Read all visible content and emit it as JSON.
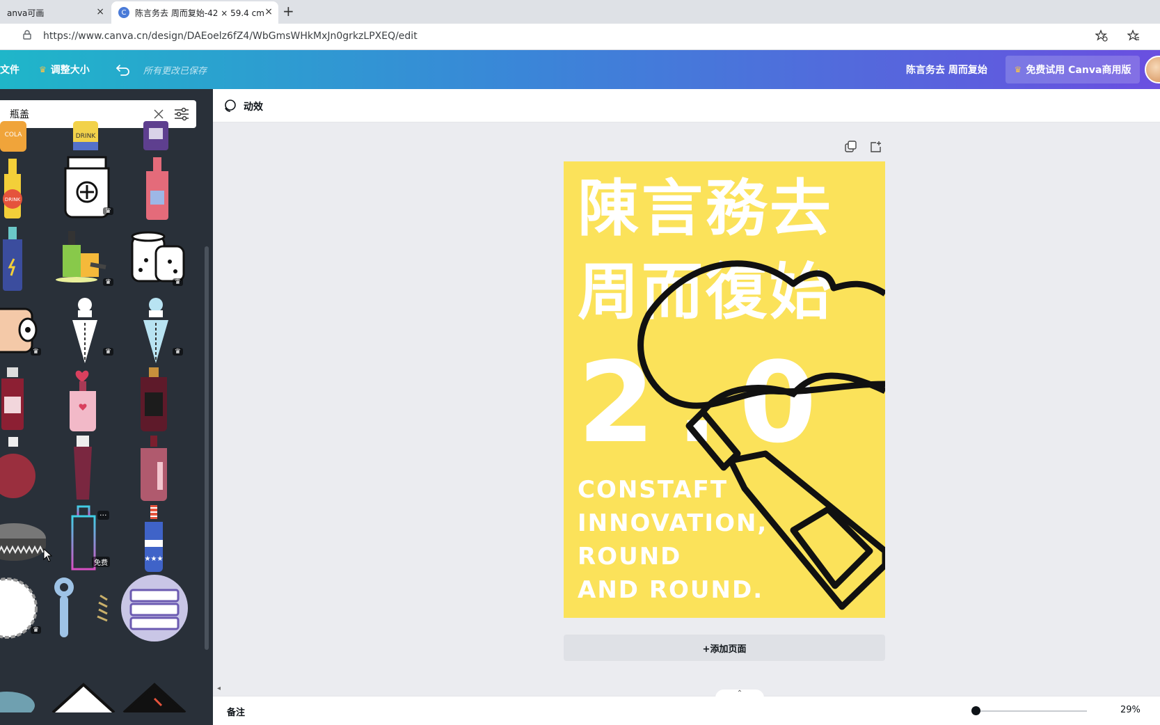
{
  "browser": {
    "tabs": [
      {
        "title": "anva可画"
      },
      {
        "title": "陈言务去 周而复始-42 × 59.4 cm"
      }
    ],
    "new_tab_symbol": "+",
    "close_symbol": "×",
    "favicon_letter": "C",
    "url": "https://www.canva.cn/design/DAEoelz6fZ4/WbGmsWHkMxJn0grkzLPXEQ/edit"
  },
  "header": {
    "file_label": "文件",
    "resize_label": "调整大小",
    "saved_status": "所有更改已保存",
    "design_title": "陈言务去 周而复始",
    "pro_button": "免费试用 Canva商用版"
  },
  "left_panel": {
    "search_value": "瓶盖",
    "free_badge": "免费",
    "more_symbol": "···",
    "collapse_symbol": "‹"
  },
  "toolbar": {
    "animate_label": "动效"
  },
  "poster": {
    "line1": "陳言務去",
    "line2": "周而復始",
    "big_number": "2.0",
    "english": [
      "CONSTAFT",
      "INNOVATION,",
      "ROUND",
      "AND ROUND."
    ]
  },
  "canvas": {
    "add_page": "+添加页面"
  },
  "bottom": {
    "notes_label": "备注",
    "zoom": "29%",
    "up_arrow": "⌃"
  },
  "colors": {
    "poster_bg": "#fbe25a",
    "panel_bg": "#293039",
    "header_gradient_start": "#1fb6c9",
    "header_gradient_end": "#6a4fe0"
  }
}
